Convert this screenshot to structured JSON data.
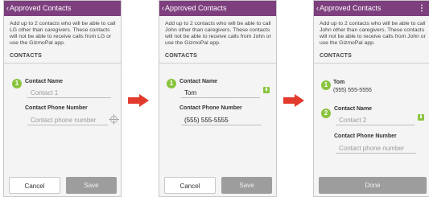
{
  "panels": [
    {
      "title": "Approved Contacts",
      "description": "Add up to 2 contacts who will be able to call LG other than caregivers. These contacts will not be able to receive calls from LG or use the GizmoPal app.",
      "section": "CONTACTS",
      "step1": "1",
      "name_label": "Contact Name",
      "name_placeholder": "Contact 1",
      "phone_label": "Contact Phone Number",
      "phone_placeholder": "Contact phone number",
      "cancel": "Cancel",
      "save": "Save"
    },
    {
      "title": "Approved Contacts",
      "description": "Add up to 2 contacts who will be able to call John other than caregivers. These contacts will not be able to receive calls from John or use the GizmoPal app.",
      "section": "CONTACTS",
      "step1": "1",
      "name_label": "Contact Name",
      "name_value": "Tom",
      "phone_label": "Contact Phone Number",
      "phone_value": "(555) 555-5555",
      "cancel": "Cancel",
      "save": "Save"
    },
    {
      "title": "Approved Contacts",
      "menu": "⋮",
      "description": "Add up to 2 contacts who will be able to call John other than caregivers. These contacts will not be able to receive calls from John or use the GizmoPal app.",
      "section": "CONTACTS",
      "step1": "1",
      "saved_name": "Tom",
      "saved_phone": "(555) 555-5555",
      "step2": "2",
      "name_label": "Contact Name",
      "name_placeholder": "Contact 2",
      "phone_label": "Contact Phone Number",
      "phone_placeholder": "Contact phone number",
      "done": "Done"
    }
  ],
  "colors": {
    "header": "#7d3f7d",
    "step": "#8ac43f",
    "arrow": "#e23b2e"
  }
}
